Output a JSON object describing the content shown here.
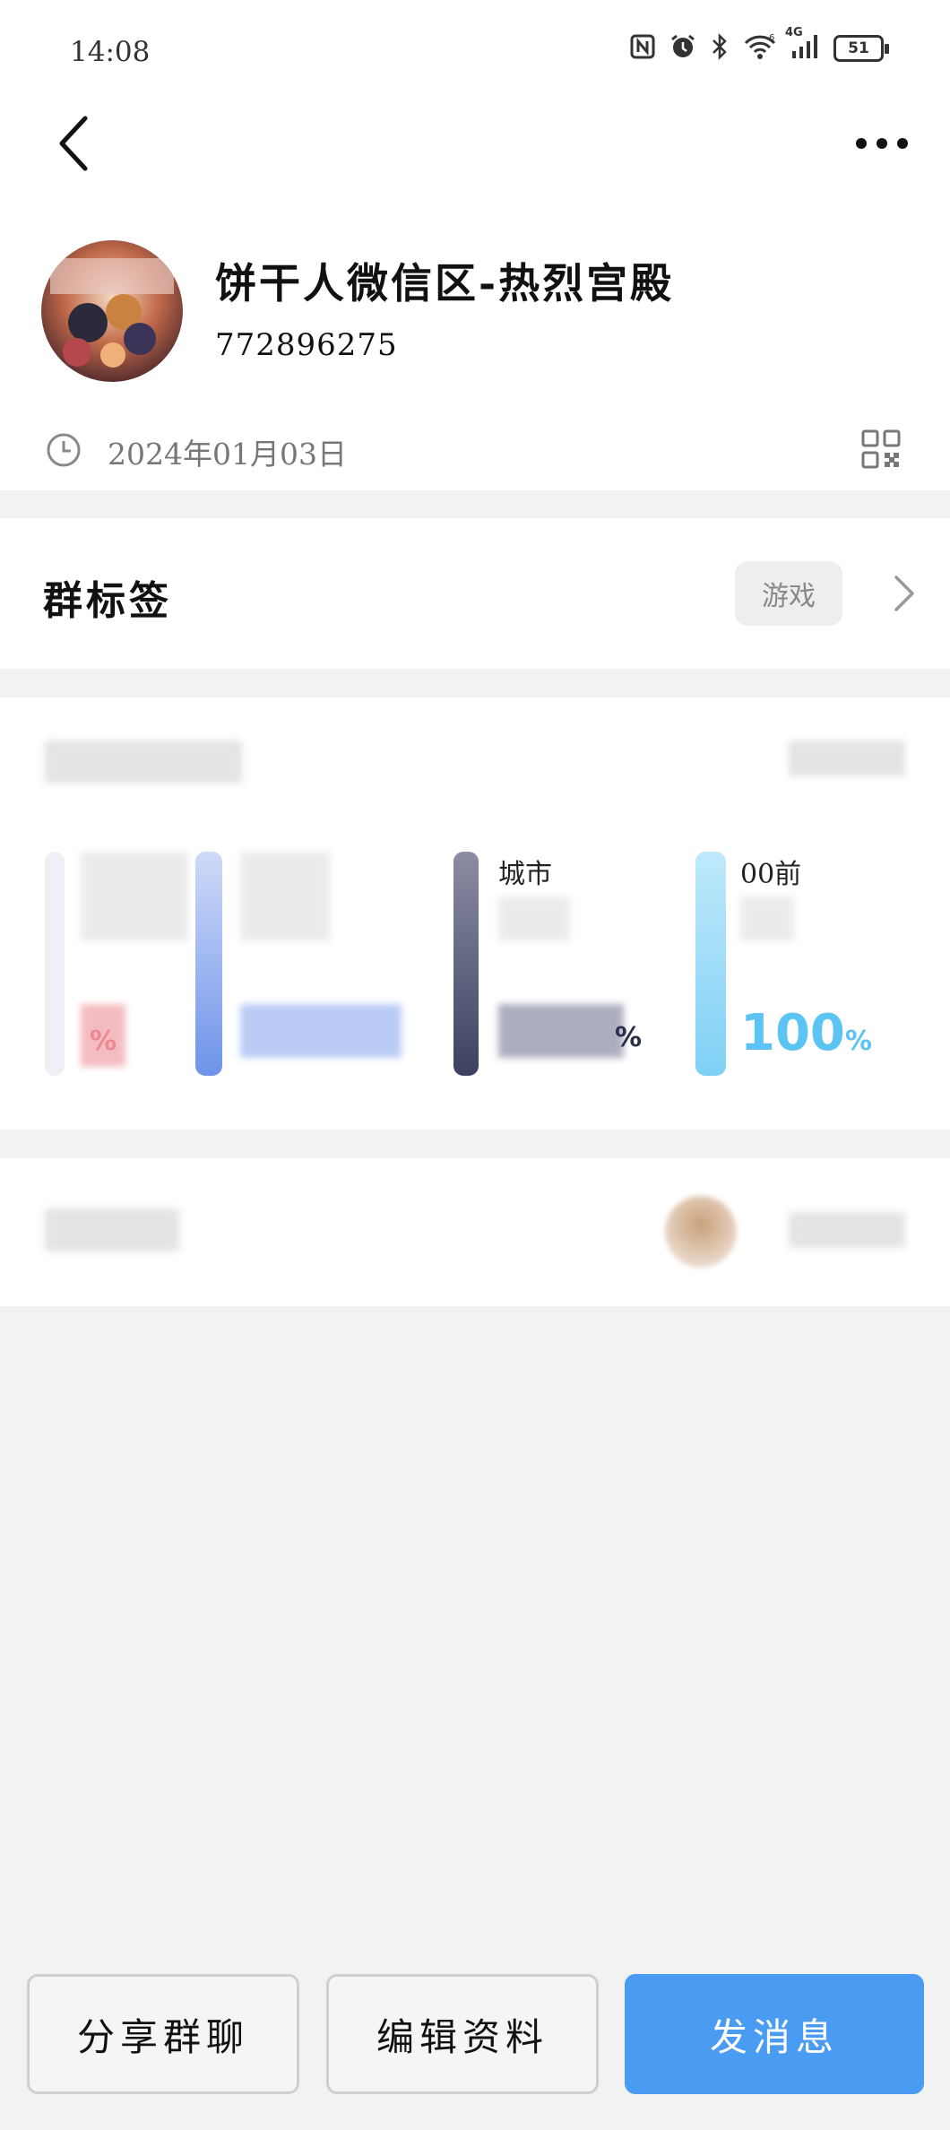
{
  "status_bar": {
    "time": "14:08",
    "battery": "51",
    "network_label": "4G",
    "icons": [
      "nfc-icon",
      "alarm-icon",
      "bluetooth-icon",
      "wifi-icon",
      "signal-icon",
      "battery-icon"
    ]
  },
  "header": {
    "back_icon": "chevron-left-icon",
    "more_icon": "more-dots-icon"
  },
  "group": {
    "name": "饼干人微信区-热烈宫殿",
    "id": "772896275",
    "created_date": "2024年01月03日"
  },
  "tags": {
    "title": "群标签",
    "chip": "游戏"
  },
  "stats": {
    "cards": [
      {
        "label": "",
        "value": "",
        "color": "#e7555f",
        "bar_color": "#f0f0f6"
      },
      {
        "label": "",
        "value": "",
        "color": "#4b7ce6",
        "bar_color": "#7aa0ef"
      },
      {
        "label": "城市",
        "value": "",
        "color": "#2b2f4a",
        "bar_color": "#5b5f78"
      },
      {
        "label": "00前",
        "value": "100",
        "color": "#5bc4f3",
        "bar_color": "#8fd6f7"
      }
    ],
    "percent_sign": "%"
  },
  "members": {
    "title": ""
  },
  "bottom": {
    "share": "分享群聊",
    "edit": "编辑资料",
    "message": "发消息"
  },
  "colors": {
    "accent": "#4a9bf2",
    "background": "#f2f2f2"
  }
}
